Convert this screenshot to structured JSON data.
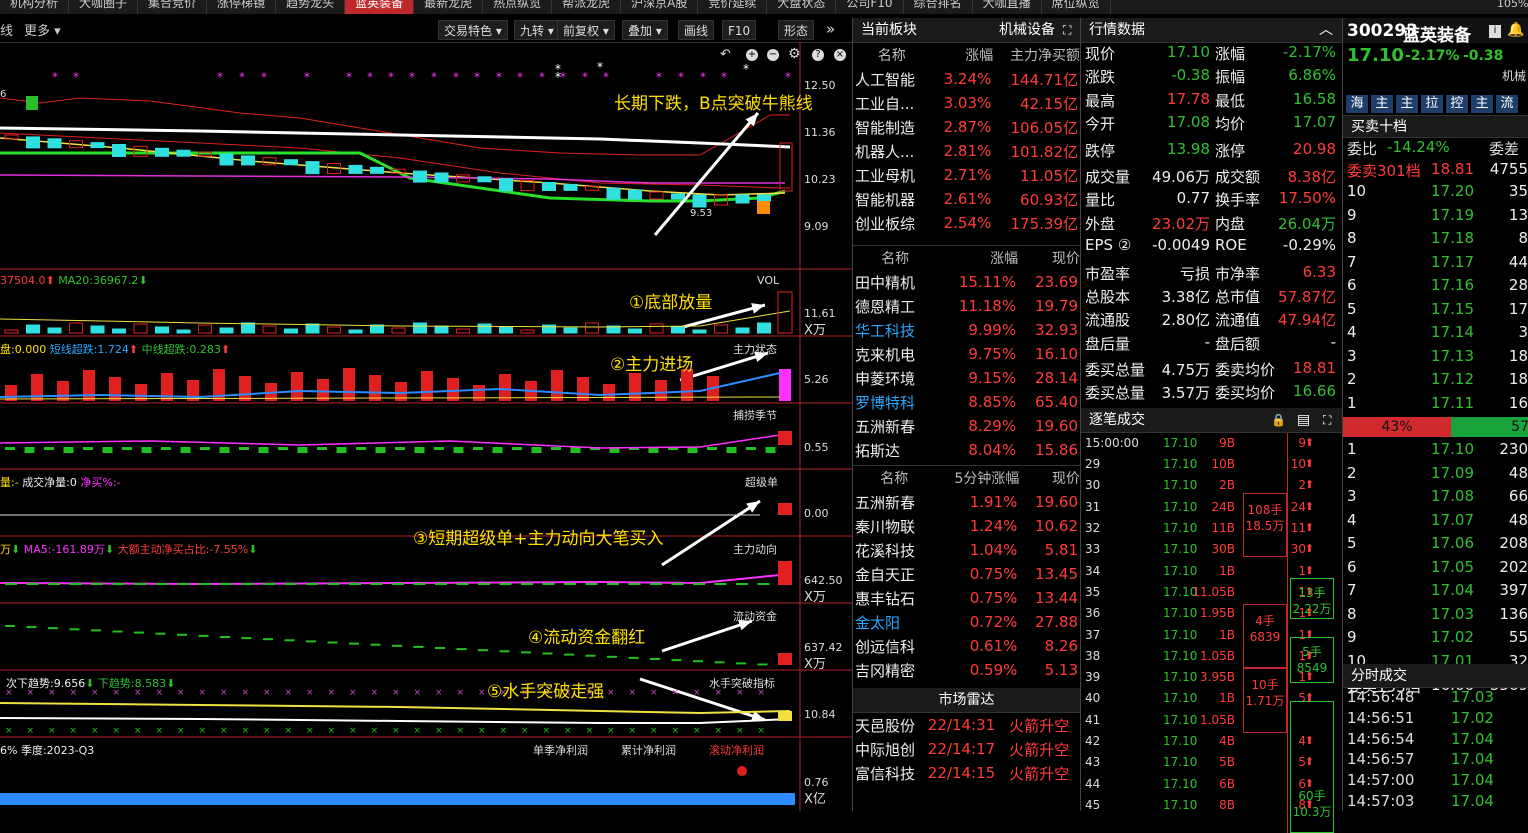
{
  "tabs": [
    "机构分析",
    "大咖圈子",
    "集合竞价",
    "涨停梯镜",
    "趋势龙头",
    "蓝英装备",
    "最新龙虎",
    "热点纵览",
    "帮派龙虎",
    "沪深京A股",
    "竞价延续",
    "大盘状态",
    "公司F10",
    "综合排名",
    "大咖直播",
    "席位纵览"
  ],
  "zoom": "105%",
  "toolbar": {
    "left": "线",
    "more": "更多",
    "buttons": [
      "交易特色",
      "九转",
      "前复权",
      "叠加",
      "画线",
      "F10",
      "形态"
    ]
  },
  "chart": {
    "y_labels": [
      "12.50",
      "11.36",
      "10.23",
      "9.09"
    ],
    "left_mark": "6",
    "low_label": "9.53",
    "annotation_main": "长期下跌，B点突破牛熊线",
    "vol": {
      "title": "37504.0",
      "ma20": "MA20:36967.2",
      "name": "VOL",
      "y": "11.61",
      "unit": "X万",
      "annotation": "①底部放量"
    },
    "zhuli": {
      "title_a": "盘:0.000",
      "title_b": "短线超跌:1.724",
      "title_c": "中线超跌:0.283",
      "name": "主力状态",
      "y": "5.26",
      "annotation": "②主力进场"
    },
    "buhuo": {
      "name": "捕捞季节",
      "y": "0.55"
    },
    "chaodan": {
      "title_a": "量:-",
      "title_b": "成交净量:0",
      "title_c": "净买%:-",
      "name": "超级单",
      "y": "0.00",
      "annotation": "③短期超级单+主力动向大笔买入"
    },
    "dongxiang": {
      "title_a": "万",
      "title_b": "MA5:-161.89万",
      "title_c": "大额主动净买占比:-7.55%",
      "name": "主力动向",
      "y": "642.50",
      "unit": "X万"
    },
    "liudong": {
      "name": "流动资金",
      "y": "637.42",
      "unit": "X万",
      "annotation": "④流动资金翻红"
    },
    "shuishou": {
      "title_a": "次下趋势:9.656",
      "title_b": "下趋势:8.583",
      "name": "水手突破指标",
      "y": "10.84",
      "annotation": "⑤水手突破走强"
    },
    "profit": {
      "title_a": "6%",
      "title_b": "季度:2023-Q3",
      "t1": "单季净利润",
      "t2": "累计净利润",
      "t3": "滚动净利润",
      "y": "0.76",
      "unit": "X亿"
    }
  },
  "sector": {
    "title": "当前板块",
    "sub": "机械设备",
    "h1": [
      "名称",
      "涨幅",
      "主力净买额"
    ],
    "rows1": [
      [
        "人工智能",
        "3.24%",
        "144.71亿"
      ],
      [
        "工业自...",
        "3.03%",
        "42.15亿"
      ],
      [
        "智能制造",
        "2.87%",
        "106.05亿"
      ],
      [
        "机器人...",
        "2.81%",
        "101.82亿"
      ],
      [
        "工业母机",
        "2.71%",
        "11.05亿"
      ],
      [
        "智能机器",
        "2.61%",
        "60.93亿"
      ],
      [
        "创业板综",
        "2.54%",
        "175.39亿"
      ]
    ],
    "h2": [
      "名称",
      "涨幅",
      "现价"
    ],
    "rows2": [
      [
        "田中精机",
        "15.11%",
        "23.69"
      ],
      [
        "德恩精工",
        "11.18%",
        "19.79"
      ],
      [
        "华工科技",
        "9.99%",
        "32.93"
      ],
      [
        "克来机电",
        "9.75%",
        "16.10"
      ],
      [
        "申菱环境",
        "9.15%",
        "28.14"
      ],
      [
        "罗博特科",
        "8.85%",
        "65.40"
      ],
      [
        "五洲新春",
        "8.29%",
        "19.60"
      ],
      [
        "拓斯达",
        "8.04%",
        "15.86"
      ]
    ],
    "h3": [
      "名称",
      "5分钟涨幅",
      "现价"
    ],
    "rows3": [
      [
        "五洲新春",
        "1.91%",
        "19.60"
      ],
      [
        "秦川物联",
        "1.24%",
        "10.62"
      ],
      [
        "花溪科技",
        "1.04%",
        "5.81"
      ],
      [
        "金自天正",
        "0.75%",
        "13.45"
      ],
      [
        "惠丰钻石",
        "0.75%",
        "13.44"
      ],
      [
        "金太阳",
        "0.72%",
        "27.88"
      ],
      [
        "创远信科",
        "0.61%",
        "8.26"
      ],
      [
        "吉冈精密",
        "0.59%",
        "5.13"
      ]
    ],
    "radar_title": "市场雷达",
    "radar": [
      [
        "天邑股份",
        "22/14:31",
        "火箭升空"
      ],
      [
        "中际旭创",
        "22/14:17",
        "火箭升空"
      ],
      [
        "富信科技",
        "22/14:15",
        "火箭升空"
      ]
    ]
  },
  "quote": {
    "title": "行情数据",
    "rows": [
      [
        "现价",
        "17.10",
        "涨幅",
        "-2.17%"
      ],
      [
        "涨跌",
        "-0.38",
        "振幅",
        "6.86%"
      ],
      [
        "最高",
        "17.78",
        "最低",
        "16.58"
      ],
      [
        "今开",
        "17.08",
        "均价",
        "17.07"
      ],
      [
        "跌停",
        "13.98",
        "涨停",
        "20.98"
      ],
      [
        "成交量",
        "49.06万",
        "成交额",
        "8.38亿"
      ],
      [
        "量比",
        "0.77",
        "换手率",
        "17.50%"
      ],
      [
        "外盘",
        "23.02万",
        "内盘",
        "26.04万"
      ],
      [
        "EPS ②",
        "-0.0049",
        "ROE",
        "-0.29%"
      ],
      [
        "市盈率",
        "亏损",
        "市净率",
        "6.33"
      ],
      [
        "总股本",
        "3.38亿",
        "总市值",
        "57.87亿"
      ],
      [
        "流通股",
        "2.80亿",
        "流通值",
        "47.94亿"
      ],
      [
        "盘后量",
        "-",
        "盘后额",
        "-"
      ],
      [
        "委买总量",
        "4.75万",
        "委卖均价",
        "18.81"
      ],
      [
        "委买总量",
        "3.57万",
        "委买均价",
        "16.66"
      ]
    ],
    "ticks_title": "逐笔成交",
    "ticks": [
      [
        "15:00:00",
        "17.10",
        "9B"
      ],
      [
        "29",
        "17.10",
        "10B"
      ],
      [
        "30",
        "17.10",
        "2B"
      ],
      [
        "31",
        "17.10",
        "24B"
      ],
      [
        "32",
        "17.10",
        "11B"
      ],
      [
        "33",
        "17.10",
        "30B"
      ],
      [
        "34",
        "17.10",
        "1B"
      ],
      [
        "35",
        "17.10",
        "11.05B"
      ],
      [
        "36",
        "17.10",
        "1.95B"
      ],
      [
        "37",
        "17.10",
        "1B"
      ],
      [
        "38",
        "17.10",
        "1.05B"
      ],
      [
        "39",
        "17.10",
        "3.95B"
      ],
      [
        "40",
        "17.10",
        "1B"
      ],
      [
        "41",
        "17.10",
        "1.05B"
      ],
      [
        "42",
        "17.10",
        "4B"
      ],
      [
        "43",
        "17.10",
        "5B"
      ],
      [
        "44",
        "17.10",
        "6B"
      ],
      [
        "45",
        "17.10",
        "8B"
      ]
    ],
    "bigs": [
      "108手 18.5万",
      "4手 6839",
      "10手 1.71万"
    ],
    "smalls": [
      "13手 2.22万",
      "5手 8549",
      "60手 10.3万"
    ],
    "arrows": [
      "9",
      "10",
      "2",
      "24",
      "11",
      "30",
      "1",
      "1",
      "1",
      "1",
      "1",
      "1",
      "5",
      "",
      "4",
      "5",
      "6",
      "8"
    ]
  },
  "stock": {
    "code": "300293",
    "name": "蓝英装备",
    "price": "17.10",
    "pct": "-2.17%",
    "chg": "-0.38",
    "tag": "机械",
    "btns": [
      "海",
      "主",
      "主",
      "拉",
      "控",
      "主",
      "流"
    ],
    "book_title": "买卖十档",
    "wb_label": "委比",
    "wb": "-14.24%",
    "wc": "委差",
    "sell_head": [
      "委卖301档",
      "18.81",
      "4755"
    ],
    "sells": [
      [
        "10",
        "17.20",
        "35"
      ],
      [
        "9",
        "17.19",
        "13"
      ],
      [
        "8",
        "17.18",
        "8"
      ],
      [
        "7",
        "17.17",
        "44"
      ],
      [
        "6",
        "17.16",
        "28"
      ],
      [
        "5",
        "17.15",
        "17"
      ],
      [
        "4",
        "17.14",
        "3"
      ],
      [
        "3",
        "17.13",
        "18"
      ],
      [
        "2",
        "17.12",
        "18"
      ],
      [
        "1",
        "17.11",
        "16"
      ]
    ],
    "bar_left": "43%",
    "bar_right": "57",
    "buys": [
      [
        "1",
        "17.10",
        "230"
      ],
      [
        "2",
        "17.09",
        "48"
      ],
      [
        "3",
        "17.08",
        "66"
      ],
      [
        "4",
        "17.07",
        "48"
      ],
      [
        "5",
        "17.06",
        "208"
      ],
      [
        "6",
        "17.05",
        "202"
      ],
      [
        "7",
        "17.04",
        "397"
      ],
      [
        "8",
        "17.03",
        "136"
      ],
      [
        "9",
        "17.02",
        "55"
      ],
      [
        "10",
        "17.01",
        "32"
      ]
    ],
    "buy_head": [
      "委买193档",
      "16.66",
      "3569"
    ],
    "fs_title": "分时成交",
    "fs": [
      [
        "14:56:48",
        "17.03"
      ],
      [
        "14:56:51",
        "17.02"
      ],
      [
        "14:56:54",
        "17.04"
      ],
      [
        "14:56:57",
        "17.04"
      ],
      [
        "14:57:00",
        "17.04"
      ],
      [
        "14:57:03",
        "17.04"
      ]
    ]
  },
  "colors": {
    "up": "#ff3b3b",
    "down": "#30c030",
    "accent": "#c0282c",
    "yellow": "#ffe100"
  }
}
